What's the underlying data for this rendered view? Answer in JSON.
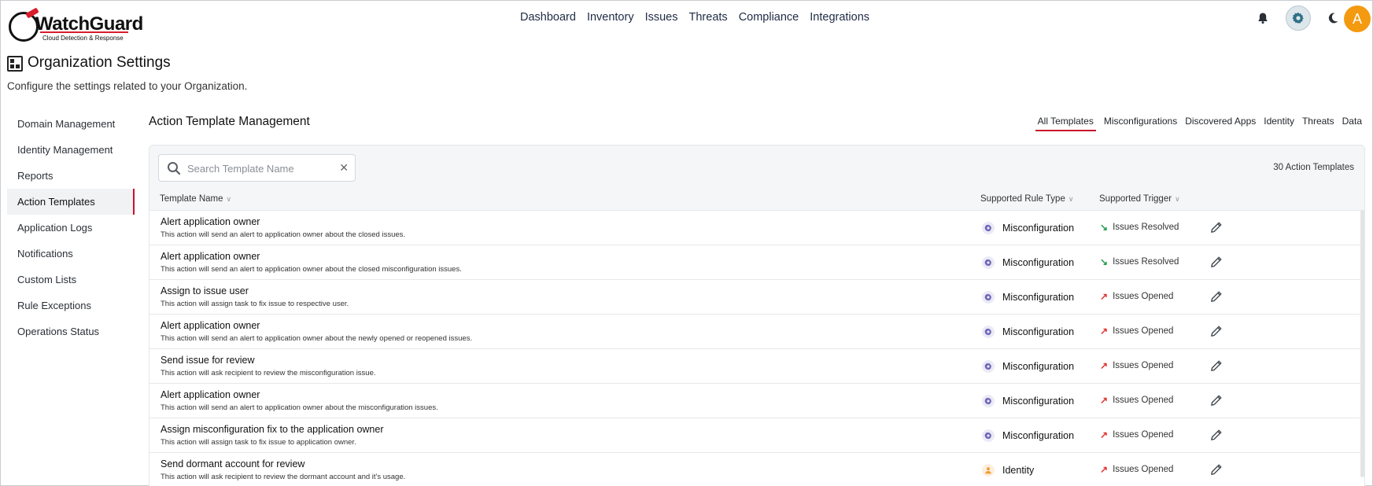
{
  "brand": {
    "name": "WatchGuard",
    "tagline": "Cloud Detection & Response"
  },
  "nav": [
    "Dashboard",
    "Inventory",
    "Issues",
    "Threats",
    "Compliance",
    "Integrations"
  ],
  "header_icons": [
    "bell-icon",
    "gear-icon",
    "moon-icon"
  ],
  "user": {
    "avatar_initial": "A",
    "avatar_color": "#f49a10"
  },
  "page": {
    "title": "Organization Settings",
    "subtitle": "Configure the settings related to your Organization."
  },
  "sidebar": {
    "items": [
      {
        "label": "Domain Management",
        "active": false
      },
      {
        "label": "Identity Management",
        "active": false
      },
      {
        "label": "Reports",
        "active": false
      },
      {
        "label": "Action Templates",
        "active": true
      },
      {
        "label": "Application Logs",
        "active": false
      },
      {
        "label": "Notifications",
        "active": false
      },
      {
        "label": "Custom Lists",
        "active": false
      },
      {
        "label": "Rule Exceptions",
        "active": false
      },
      {
        "label": "Operations Status",
        "active": false
      }
    ]
  },
  "main": {
    "title": "Action Template Management",
    "filter_tabs": [
      {
        "label": "All Templates",
        "active": true
      },
      {
        "label": "Misconfigurations",
        "active": false
      },
      {
        "label": "Discovered Apps",
        "active": false
      },
      {
        "label": "Identity",
        "active": false
      },
      {
        "label": "Threats",
        "active": false
      },
      {
        "label": "Data",
        "active": false
      }
    ],
    "search": {
      "placeholder": "Search Template Name",
      "value": ""
    },
    "count_label": "30 Action Templates",
    "columns": {
      "name": "Template Name",
      "rule_type": "Supported Rule Type",
      "trigger": "Supported Trigger"
    },
    "rows": [
      {
        "name": "Alert application owner",
        "desc": "This action will send an alert to application owner about the closed issues.",
        "rule_type": "Misconfiguration",
        "rule_icon": "gear-icon",
        "trigger": "Issues Resolved",
        "trigger_dir": "down"
      },
      {
        "name": "Alert application owner",
        "desc": "This action will send an alert to application owner about the closed misconfiguration issues.",
        "rule_type": "Misconfiguration",
        "rule_icon": "gear-icon",
        "trigger": "Issues Resolved",
        "trigger_dir": "down"
      },
      {
        "name": "Assign to issue user",
        "desc": "This action will assign task to fix issue to respective user.",
        "rule_type": "Misconfiguration",
        "rule_icon": "gear-icon",
        "trigger": "Issues Opened",
        "trigger_dir": "up"
      },
      {
        "name": "Alert application owner",
        "desc": "This action will send an alert to application owner about the newly opened or reopened issues.",
        "rule_type": "Misconfiguration",
        "rule_icon": "gear-icon",
        "trigger": "Issues Opened",
        "trigger_dir": "up"
      },
      {
        "name": "Send issue for review",
        "desc": "This action will ask recipient to review the misconfiguration issue.",
        "rule_type": "Misconfiguration",
        "rule_icon": "gear-icon",
        "trigger": "Issues Opened",
        "trigger_dir": "up"
      },
      {
        "name": "Alert application owner",
        "desc": "This action will send an alert to application owner about the misconfiguration issues.",
        "rule_type": "Misconfiguration",
        "rule_icon": "gear-icon",
        "trigger": "Issues Opened",
        "trigger_dir": "up"
      },
      {
        "name": "Assign misconfiguration fix to the application owner",
        "desc": "This action will assign task to fix issue to application owner.",
        "rule_type": "Misconfiguration",
        "rule_icon": "gear-icon",
        "trigger": "Issues Opened",
        "trigger_dir": "up"
      },
      {
        "name": "Send dormant account for review",
        "desc": "This action will ask recipient to review the dormant account and it's usage.",
        "rule_type": "Identity",
        "rule_icon": "user-icon",
        "trigger": "Issues Opened",
        "trigger_dir": "up"
      }
    ]
  },
  "colors": {
    "accent_red": "#c8102e",
    "resolved_green": "#1e9e4a",
    "opened_red": "#e0322f",
    "misconfig_icon": "#6b63b5",
    "identity_icon": "#f0a030"
  }
}
